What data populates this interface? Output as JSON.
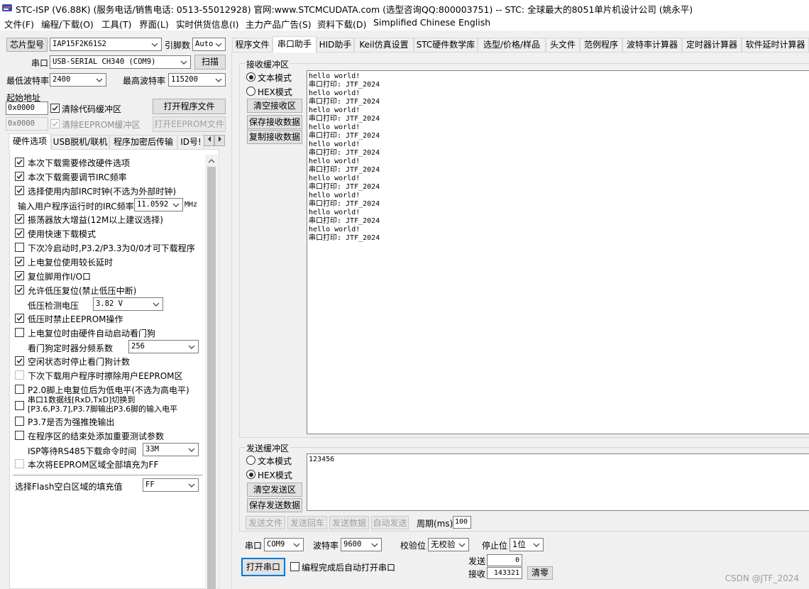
{
  "window": {
    "title": "STC-ISP (V6.88K) (服务电话/销售电话: 0513-55012928) 官网:www.STCMCUDATA.com  (选型咨询QQ:800003751) -- STC: 全球最大的8051单片机设计公司 (姚永平)"
  },
  "menu": [
    "文件(F)",
    "编程/下载(O)",
    "工具(T)",
    "界面(L)",
    "实时供货信息(I)",
    "主力产品广告(S)",
    "资料下载(D)",
    "Simplified Chinese",
    "English"
  ],
  "left": {
    "chip_label": "芯片型号",
    "chip_value": "IAP15F2K61S2",
    "pin_label": "引脚数",
    "pin_value": "Auto",
    "port_label": "串口",
    "port_value": "USB-SERIAL CH340 (COM9)",
    "scan_button": "扫描",
    "min_baud_label": "最低波特率",
    "min_baud_value": "2400",
    "max_baud_label": "最高波特率",
    "max_baud_value": "115200",
    "start_addr_label": "起始地址",
    "addr1": "0x0000",
    "clear_code_label": "清除代码缓冲区",
    "open_program_button": "打开程序文件",
    "addr2": "0x0000",
    "clear_eeprom_label": "清除EEPROM缓冲区",
    "open_eeprom_button": "打开EEPROM文件",
    "tabs": [
      "硬件选项",
      "USB脱机/联机",
      "程序加密后传输",
      "ID号!"
    ],
    "hw_options": {
      "opt1": "本次下载需要修改硬件选项",
      "opt2": "本次下载需要调节IRC频率",
      "opt3": "选择使用内部IRC时钟(不选为外部时钟)",
      "irc_label": "输入用户程序运行时的IRC频率",
      "irc_value": "11.0592",
      "irc_unit": "MHz",
      "opt4": "振荡器放大增益(12M以上建议选择)",
      "opt5": "使用快速下载模式",
      "opt6": "下次冷启动时,P3.2/P3.3为0/0才可下载程序",
      "opt7": "上电复位使用较长延时",
      "opt8": "复位脚用作I/O口",
      "opt9": "允许低压复位(禁止低压中断)",
      "lvd_label": "低压检测电压",
      "lvd_value": "3.82 V",
      "opt10": "低压时禁止EEPROM操作",
      "opt11": "上电复位时由硬件自动启动看门狗",
      "wdt_label": "看门狗定时器分频系数",
      "wdt_value": "256",
      "opt12": "空闲状态时停止看门狗计数",
      "opt13": "下次下载用户程序时擦除用户EEPROM区",
      "opt14": "P2.0脚上电复位后为低电平(不选为高电平)",
      "opt15_line1": "串口1数据线[RxD,TxD]切换到",
      "opt15_line2": "[P3.6,P3.7],P3.7脚输出P3.6脚的输入电平",
      "opt16": "P3.7是否为强推挽输出",
      "opt17": "在程序区的结束处添加重要测试参数",
      "isp_label": "ISP等待RS485下载命令时间",
      "isp_value": "33M",
      "opt18": "本次将EEPROM区域全部填充为FF",
      "fill_label": "选择Flash空白区域的填充值",
      "fill_value": "FF"
    }
  },
  "right": {
    "tabs": [
      "程序文件",
      "串口助手",
      "HID助手",
      "Keil仿真设置",
      "STC硬件数学库",
      "选型/价格/样品",
      "头文件",
      "范例程序",
      "波特率计算器",
      "定时器计算器",
      "软件延时计算器"
    ],
    "recv_group": "接收缓冲区",
    "text_mode": "文本模式",
    "hex_mode": "HEX模式",
    "clear_recv": "清空接收区",
    "save_recv": "保存接收数据",
    "copy_recv": "复制接收数据",
    "recv_lines": [
      "hello world!",
      "串口打印: JTF_2024",
      "hello world!",
      "串口打印: JTF_2024",
      "hello world!",
      "串口打印: JTF_2024",
      "hello world!",
      "串口打印: JTF_2024",
      "hello world!",
      "串口打印: JTF_2024",
      "hello world!",
      "串口打印: JTF_2024",
      "hello world!",
      "串口打印: JTF_2024",
      "hello world!",
      "串口打印: JTF_2024",
      "hello world!",
      "串口打印: JTF_2024",
      "hello world!",
      "串口打印: JTF_2024"
    ],
    "send_group": "发送缓冲区",
    "clear_send": "清空发送区",
    "save_send": "保存发送数据",
    "send_content": "123456",
    "send_file": "发送文件",
    "send_enter": "发送回车",
    "send_data": "发送数据",
    "auto_send": "自动发送",
    "period_label": "周期(ms)",
    "period_value": "100",
    "port_label": "串口",
    "port_value": "COM9",
    "baud_label": "波特率",
    "baud_value": "9600",
    "parity_label": "校验位",
    "parity_value": "无校验",
    "stop_label": "停止位",
    "stop_value": "1位",
    "open_port": "打开串口",
    "auto_open_label": "编程完成后自动打开串口",
    "sent_label": "发送",
    "sent_value": "0",
    "recv_label": "接收",
    "recv_value": "143321",
    "clear_counts": "清零"
  },
  "watermark": "CSDN @JTF_2024"
}
